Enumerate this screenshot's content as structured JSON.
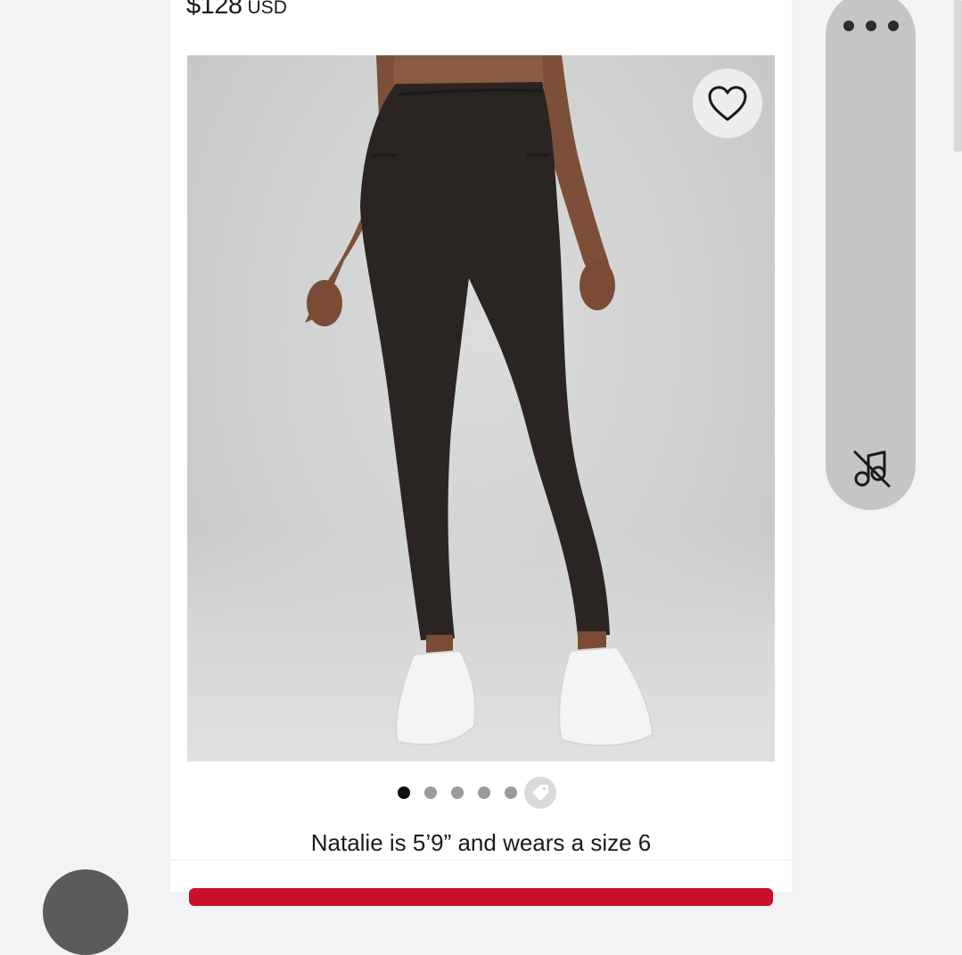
{
  "product": {
    "price": "$128",
    "currency": "USD",
    "model_caption": "Natalie is 5’9” and wears a size 6"
  },
  "gallery": {
    "image_count": 5,
    "active_index": 0
  },
  "icons": {
    "favorite": "heart-outline-icon",
    "more": "more-horizontal-icon",
    "sound": "music-off-icon",
    "gallery_tag": "price-tag-icon"
  },
  "colors": {
    "accent": "#c8102e",
    "panel": "#c4c5c6",
    "background": "#f2f3f5"
  }
}
